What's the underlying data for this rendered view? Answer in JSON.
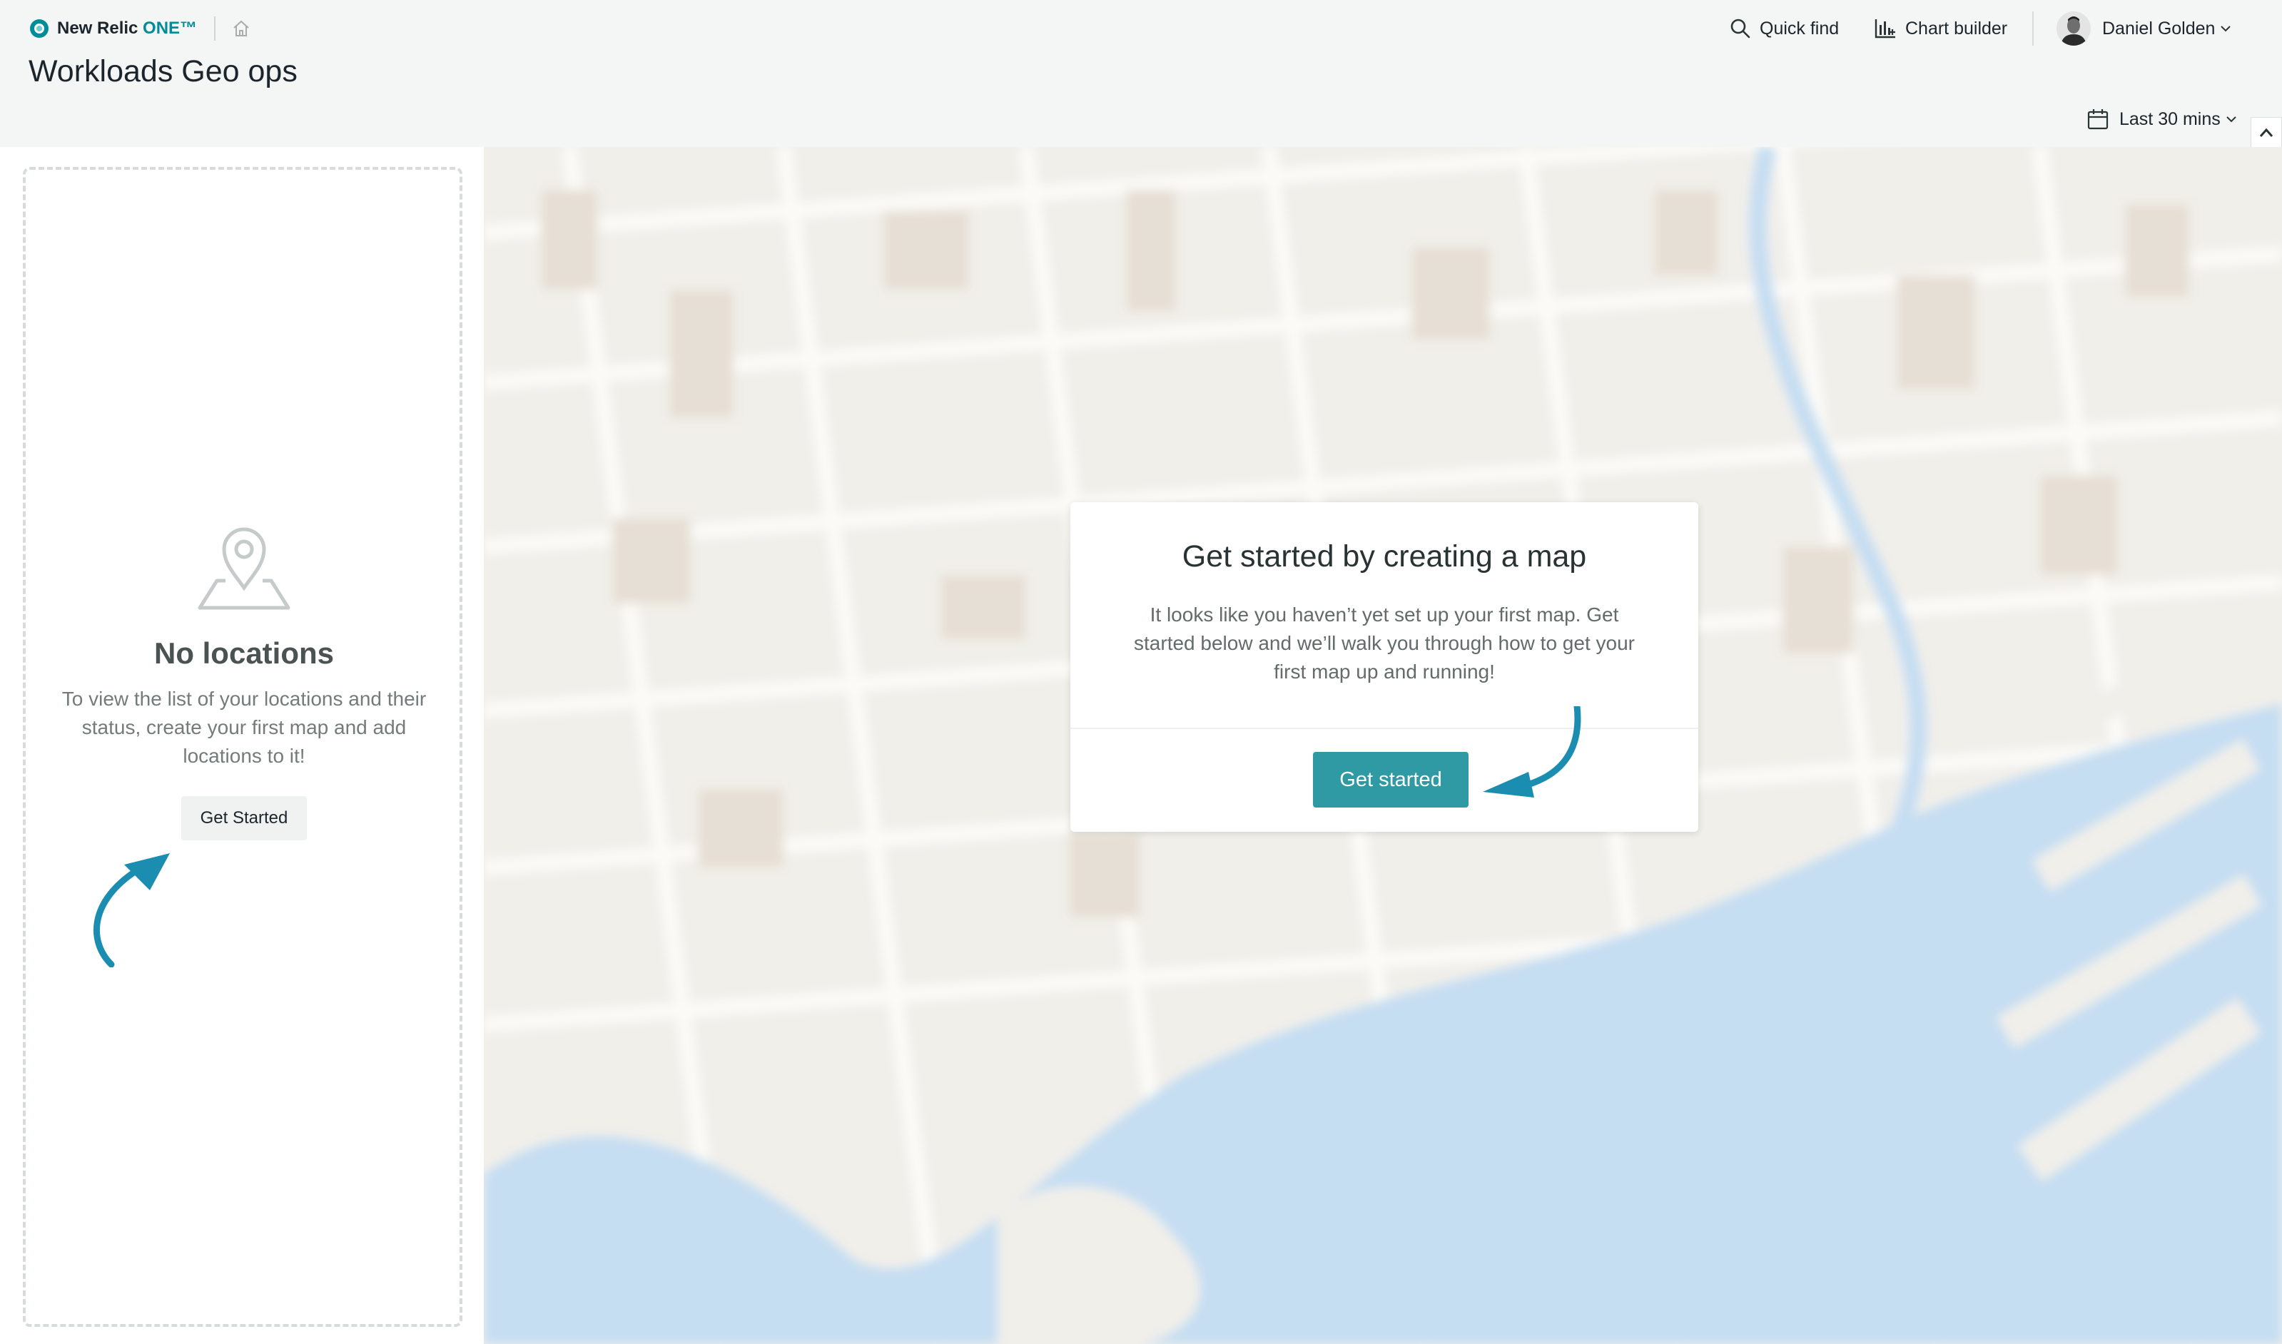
{
  "header": {
    "brand": {
      "name_prefix": "New Relic ",
      "name_suffix": "ONE™",
      "logo_icon": "new-relic-logo-icon"
    },
    "home_icon": "home-icon",
    "page_title": "Workloads Geo ops",
    "quick_find": {
      "label": "Quick find",
      "icon": "search-icon"
    },
    "chart_builder": {
      "label": "Chart builder",
      "icon": "chart-builder-icon"
    },
    "user": {
      "name": "Daniel Golden",
      "icon": "chevron-down-icon"
    },
    "time_picker": {
      "label": "Last 30 mins",
      "icon": "calendar-icon"
    },
    "collapse_icon": "chevron-up-icon"
  },
  "left_panel": {
    "icon": "map-pin-icon",
    "title": "No locations",
    "description": "To view the list of your locations and their status, create your first map and add locations to it!",
    "button_label": "Get Started"
  },
  "dialog": {
    "title": "Get started by creating a map",
    "body": "It looks like you haven’t yet set up your first map. Get started below and we’ll walk you through how to get your first map up and running!",
    "button_label": "Get started"
  },
  "colors": {
    "accent": "#2f9aa4",
    "brand_teal": "#008c99",
    "arrow": "#1a8db0",
    "water": "#c6def2",
    "land": "#f1efea"
  }
}
